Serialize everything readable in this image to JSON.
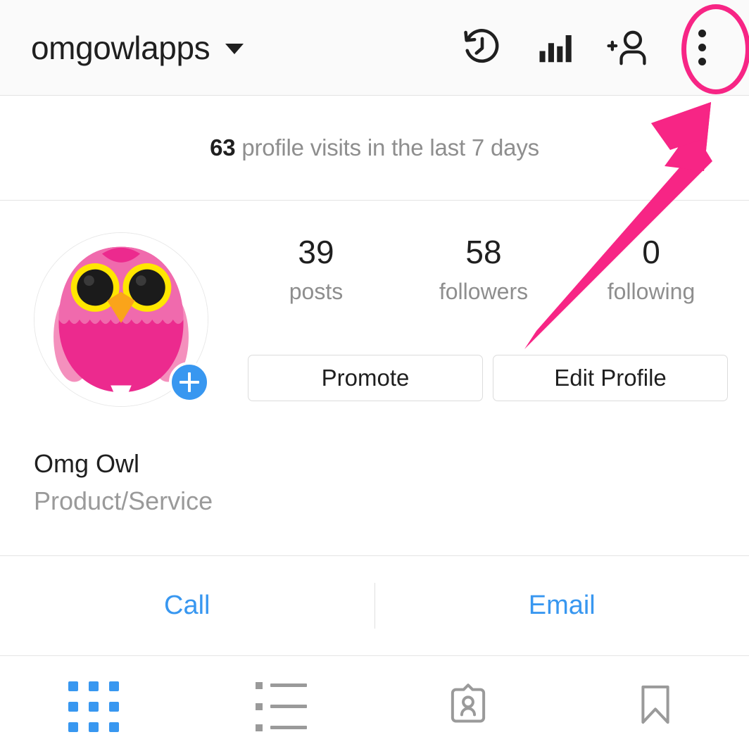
{
  "header": {
    "username": "omgowlapps",
    "dropdown_icon": "chevron-down-icon",
    "actions": [
      {
        "name": "archive-icon",
        "label": "Archive"
      },
      {
        "name": "insights-bar-chart-icon",
        "label": "Insights"
      },
      {
        "name": "discover-people-add-user-icon",
        "label": "Discover People"
      },
      {
        "name": "overflow-menu-icon",
        "label": "Menu"
      }
    ]
  },
  "annotations": {
    "highlight_color": "#f72585",
    "ellipse_target": "overflow-menu-icon",
    "arrow_points_to": "overflow-menu-icon"
  },
  "insights": {
    "count": "63",
    "text": "profile visits in the last 7 days"
  },
  "profile": {
    "avatar_alt": "omg-owl-avatar",
    "add_story_badge": "+",
    "stats": [
      {
        "value": "39",
        "label": "posts"
      },
      {
        "value": "58",
        "label": "followers"
      },
      {
        "value": "0",
        "label": "following"
      }
    ],
    "buttons": [
      {
        "name": "promote-button",
        "label": "Promote"
      },
      {
        "name": "edit-profile-button",
        "label": "Edit Profile"
      }
    ],
    "display_name": "Omg Owl",
    "category": "Product/Service"
  },
  "contact": {
    "call_label": "Call",
    "email_label": "Email"
  },
  "tabs": [
    {
      "name": "tab-grid",
      "icon": "grid-icon",
      "active": true
    },
    {
      "name": "tab-list",
      "icon": "list-icon",
      "active": false
    },
    {
      "name": "tab-tagged",
      "icon": "person-card-icon",
      "active": false
    },
    {
      "name": "tab-saved",
      "icon": "bookmark-icon",
      "active": false
    }
  ],
  "colors": {
    "accent_blue": "#3897f0",
    "annotation_pink": "#f72585",
    "text_primary": "#1f1f1f",
    "text_secondary": "#8e8e8e",
    "header_bg": "#fafafa",
    "divider": "#e4e4e4"
  }
}
